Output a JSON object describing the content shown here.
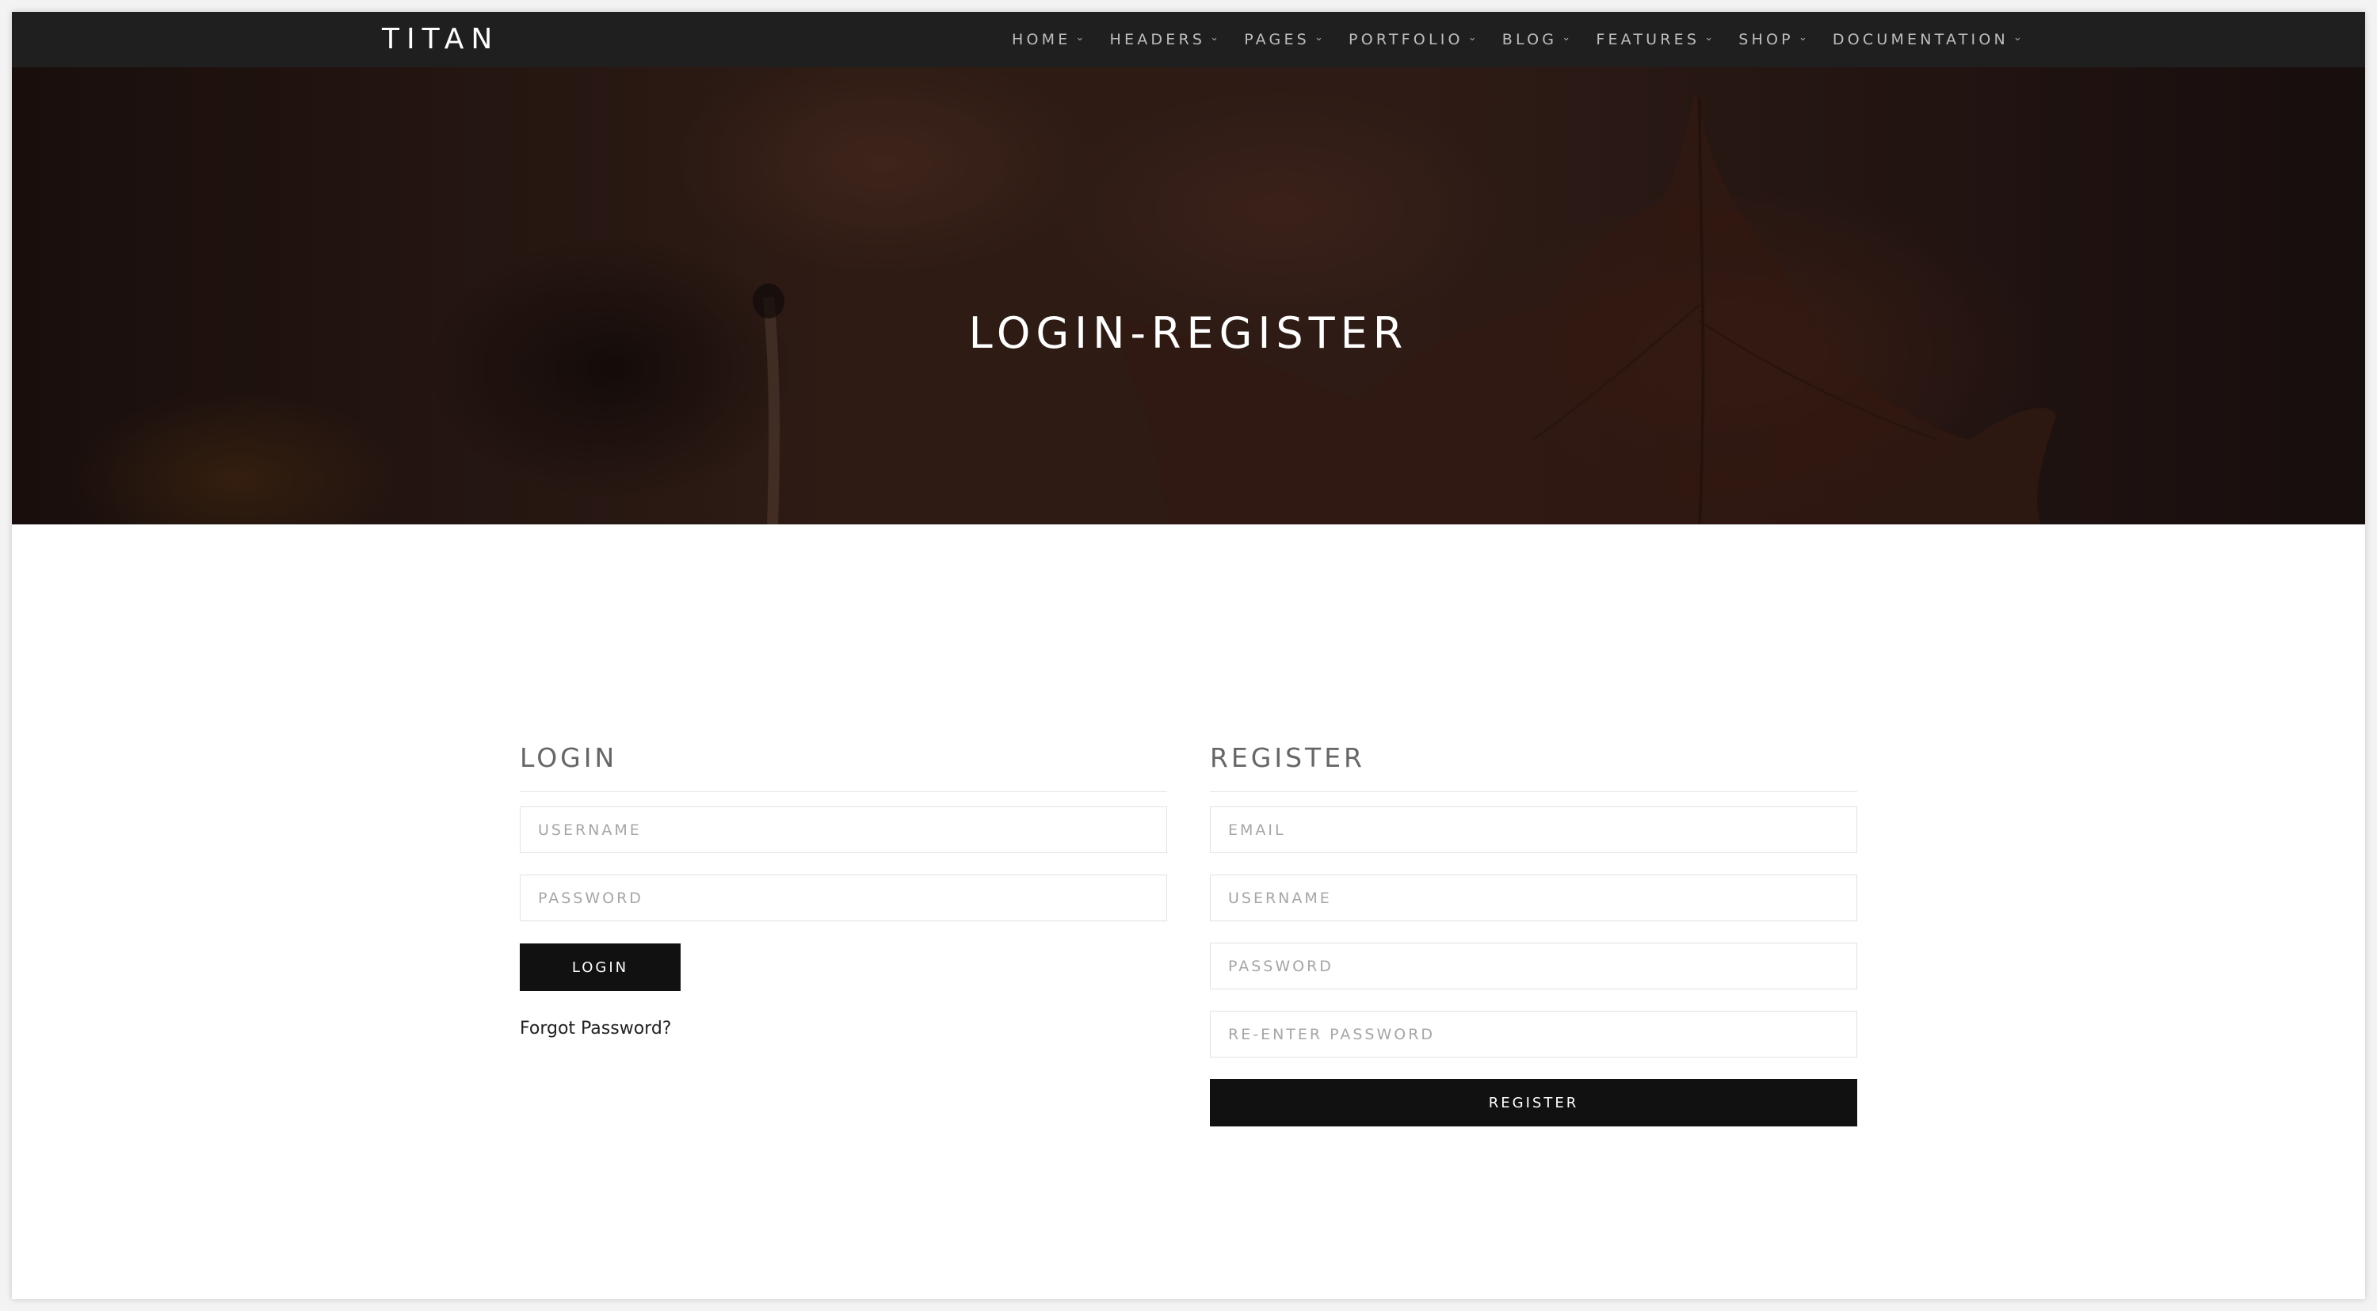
{
  "navbar": {
    "brand": "TITAN",
    "items": [
      {
        "label": "HOME"
      },
      {
        "label": "HEADERS"
      },
      {
        "label": "PAGES"
      },
      {
        "label": "PORTFOLIO"
      },
      {
        "label": "BLOG"
      },
      {
        "label": "FEATURES"
      },
      {
        "label": "SHOP"
      },
      {
        "label": "DOCUMENTATION"
      }
    ],
    "dropdown_icon": "chevron-down-icon"
  },
  "hero": {
    "title": "LOGIN-REGISTER"
  },
  "login": {
    "title": "LOGIN",
    "username_placeholder": "USERNAME",
    "password_placeholder": "PASSWORD",
    "button_label": "LOGIN",
    "forgot_label": "Forgot Password?"
  },
  "register": {
    "title": "REGISTER",
    "email_placeholder": "EMAIL",
    "username_placeholder": "USERNAME",
    "password_placeholder": "PASSWORD",
    "reenter_placeholder": "RE-ENTER PASSWORD",
    "button_label": "REGISTER"
  },
  "colors": {
    "navbar_bg": "#1f1f1f",
    "button_bg": "#111111",
    "title_text": "#666666"
  }
}
